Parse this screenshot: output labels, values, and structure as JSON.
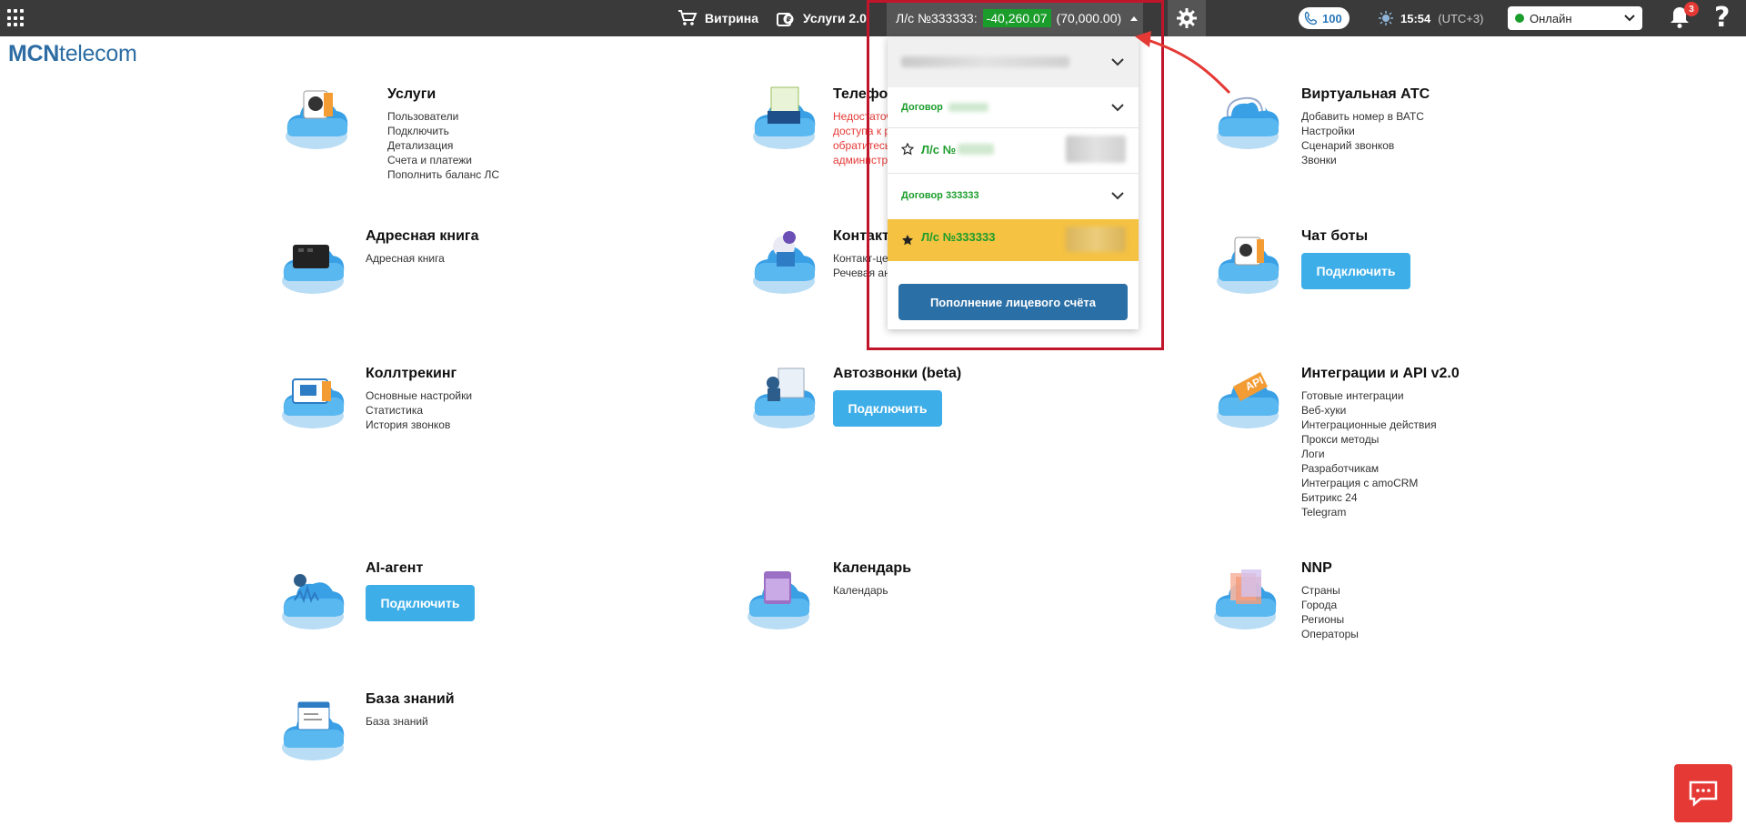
{
  "topbar": {
    "vitrina_label": "Витрина",
    "services2_label": "Услуги 2.0",
    "account_prefix": "Л/с №333333:",
    "balance": "-40,260.07",
    "credit": "(70,000.00)",
    "calls_count": "100",
    "time": "15:54",
    "timezone": "(UTC+3)",
    "status_value": "Онлайн",
    "notifications_count": "3",
    "help_label": "?"
  },
  "logo": {
    "bold": "MCN",
    "light": "telecom"
  },
  "tiles": [
    {
      "title": "Услуги",
      "links": [
        "Пользователи",
        "Подключить",
        "Детализация",
        "Счета и платежи",
        "Пополнить баланс ЛС"
      ]
    },
    {
      "title": "Телефония",
      "warning": [
        "Недостаточно прав",
        "доступа к разделу,",
        "обратитесь к",
        "администратору"
      ]
    },
    {
      "title": "Виртуальная АТС",
      "links": [
        "Добавить номер в ВАТС",
        "Настройки",
        "Сценарий звонков",
        "Звонки"
      ]
    },
    {
      "title": "Адресная книга",
      "links": [
        "Адресная книга"
      ]
    },
    {
      "title": "Контакт-центр",
      "links": [
        "Контакт-центр",
        "Речевая аналитика"
      ]
    },
    {
      "title": "Чат боты",
      "button": "Подключить"
    },
    {
      "title": "Коллтрекинг",
      "links": [
        "Основные настройки",
        "Статистика",
        "История звонков"
      ]
    },
    {
      "title": "Автозвонки (beta)",
      "button": "Подключить"
    },
    {
      "title": "Интеграции и API v2.0",
      "links": [
        "Готовые интеграции",
        "Веб-хуки",
        "Интеграционные действия",
        "Прокси методы",
        "Логи",
        "Разработчикам",
        "Интеграция с amoCRM",
        "Битрикс 24",
        "Telegram"
      ]
    },
    {
      "title": "AI-агент",
      "button": "Подключить"
    },
    {
      "title": "Календарь",
      "links": [
        "Календарь"
      ]
    },
    {
      "title": "NNP",
      "links": [
        "Страны",
        "Города",
        "Регионы",
        "Операторы"
      ]
    },
    {
      "title": "База знаний",
      "links": [
        "База знаний"
      ]
    }
  ],
  "dropdown": {
    "contract1_label": "Договор",
    "account1_label": "Л/с №",
    "contract2_label": "Договор 333333",
    "account2_label": "Л/с №333333",
    "topup_label": "Пополнение лицевого счёта"
  },
  "colors": {
    "topbar_bg": "#3a3a3a",
    "balance_green": "#1b9d2b",
    "connect_button": "#3eaee8",
    "topup_button": "#2a6fa6",
    "active_account": "#f5c242",
    "highlight_frame": "#c0152a",
    "warning_text": "#e53935"
  }
}
